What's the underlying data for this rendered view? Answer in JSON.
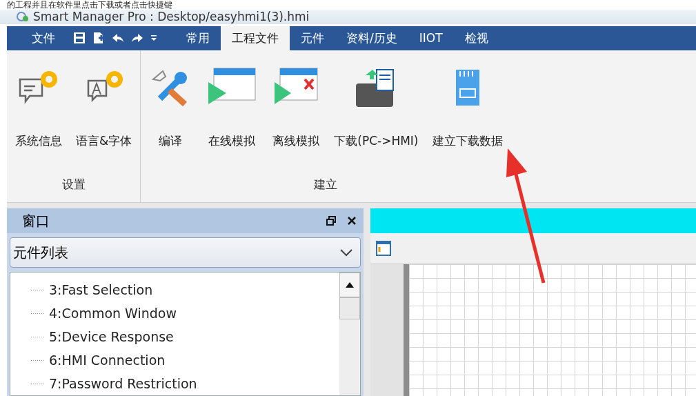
{
  "caption": "的工程并且在软件里点击下载或者点击快捷键",
  "window": {
    "title": "Smart Manager Pro : Desktop/easyhmi1(3).hmi"
  },
  "menu": {
    "file": "文件",
    "quick_access": [
      {
        "kind": "save"
      },
      {
        "kind": "new"
      },
      {
        "kind": "undo"
      },
      {
        "kind": "redo"
      },
      {
        "kind": "more"
      }
    ]
  },
  "tabs": [
    {
      "label": "常用",
      "selected": false
    },
    {
      "label": "工程文件",
      "selected": true
    },
    {
      "label": "元件",
      "selected": false
    },
    {
      "label": "资料/历史",
      "selected": false
    },
    {
      "label": "IIOT",
      "selected": false
    },
    {
      "label": "检视",
      "selected": false
    }
  ],
  "ribbon_groups": [
    {
      "label": "设置",
      "items": [
        {
          "kind": "sysinfo",
          "label": "系统信息"
        },
        {
          "kind": "language",
          "label": "语言&字体"
        }
      ]
    },
    {
      "label": "建立",
      "items": [
        {
          "kind": "compile",
          "label": "编译"
        },
        {
          "kind": "online",
          "label": "在线模拟"
        },
        {
          "kind": "offline",
          "label": "离线模拟"
        },
        {
          "kind": "download",
          "label": "下载(PC->HMI)"
        },
        {
          "kind": "sdcard",
          "label": "建立下载数据"
        }
      ]
    }
  ],
  "panel": {
    "title": "窗口",
    "dropdown": "元件列表",
    "tree": [
      "3:Fast Selection",
      "4:Common Window",
      "5:Device Response",
      "6:HMI Connection",
      "7:Password Restriction"
    ]
  }
}
